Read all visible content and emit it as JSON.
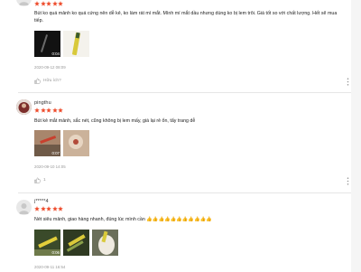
{
  "colors": {
    "star": "#ee4d2d",
    "muted": "#999999",
    "text": "#222222",
    "divider": "#e6e6e6"
  },
  "reviews": [
    {
      "username": "",
      "rating": 5,
      "comment": "Bút ko quá mảnh ko quá cứng nên dễ kẻ, ko làm rát mí mắt. Mình mí mắt dầu nhưng dùng ko bị lem trôi. Giá tốt so với chất lượng. Hết sẽ mua tiếp.",
      "media": [
        {
          "kind": "video",
          "duration": "0:04",
          "icon": "camera-icon"
        },
        {
          "kind": "image"
        }
      ],
      "timestamp": "2020-09-12 08:09",
      "like_label": "Hữu ích?",
      "like_icon": "thumbs-up-icon"
    },
    {
      "username": "pingthu",
      "rating": 5,
      "comment": "Bút kẻ mắt mảnh, sắc nét, cũng không bị lem mấy, giá lại rẻ ổn, tẩy trang dễ",
      "media": [
        {
          "kind": "video",
          "duration": "0:07",
          "icon": "camera-icon"
        },
        {
          "kind": "image"
        }
      ],
      "timestamp": "2020-09-10 14:05",
      "like_count": "1",
      "like_icon": "thumbs-up-icon"
    },
    {
      "username": "j*****4",
      "rating": 5,
      "comment": "Nét siêu mảnh, giao hàng nhanh, đúng lúc mình cần 👍👍👍👍👍👍👍👍👍👍👍",
      "media": [
        {
          "kind": "video",
          "duration": "0:06",
          "icon": "camera-icon"
        },
        {
          "kind": "image"
        },
        {
          "kind": "image"
        }
      ],
      "timestamp": "2020-09-11 16:54"
    }
  ]
}
